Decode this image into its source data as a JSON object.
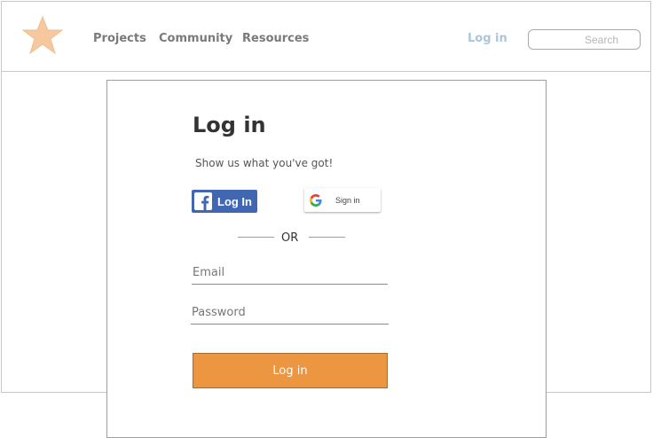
{
  "header": {
    "nav": [
      "Projects",
      "Community",
      "Resources"
    ],
    "login_link": "Log in",
    "search_placeholder": "Search"
  },
  "login_card": {
    "title": "Log in",
    "subtitle": "Show us what you've got!",
    "facebook_button": "Log In",
    "google_button": "Sign in",
    "divider_text": "OR",
    "email_placeholder": "Email",
    "password_placeholder": "Password",
    "submit_label": "Log in"
  },
  "colors": {
    "accent": "#ec9641",
    "facebook": "#4267b2",
    "logo": "#f6c89f",
    "login_link": "#a9c7d9"
  },
  "icons": {
    "logo": "star-icon",
    "facebook": "facebook-icon",
    "google": "google-icon"
  }
}
